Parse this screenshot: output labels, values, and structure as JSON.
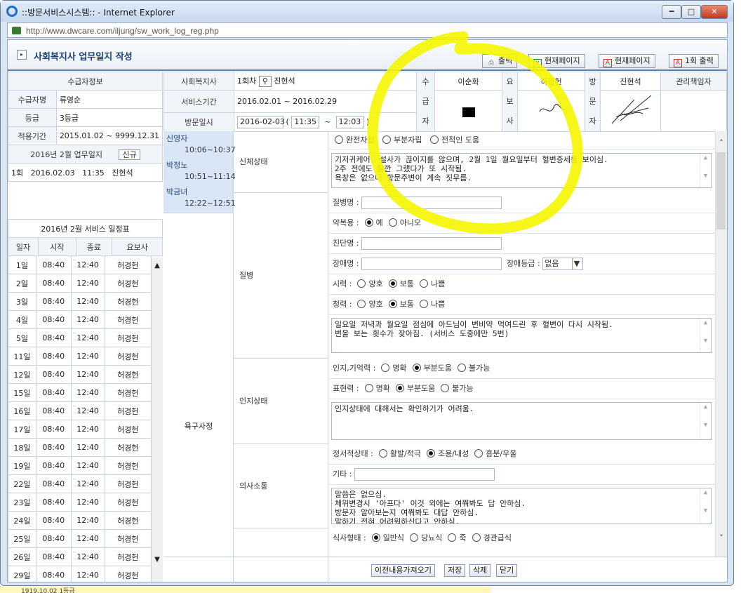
{
  "window": {
    "title": "::방문서비스시스템:: - Internet Explorer",
    "url": "http://www.dwcare.com/iljung/sw_work_log_reg.php",
    "min": "━",
    "max": "□",
    "close": "✕"
  },
  "header": {
    "title": "사회복지사 업무일지 작성",
    "buttons": {
      "print": "출력",
      "current_page_excel": "현재페이지",
      "current_page_pdf": "현재페이지",
      "print_once": "1회 출력"
    }
  },
  "recipient": {
    "section": "수급자정보",
    "name_label": "수급자명",
    "name": "류영순",
    "grade_label": "등급",
    "grade": "3등급",
    "period_label": "적용기간",
    "period": "2015.01.02 ~ 9999.12.31"
  },
  "worklog": {
    "title": "2016년 2월 업무일지",
    "new_button": "신규",
    "entries": [
      {
        "no": "1회",
        "date": "2016.02.03",
        "time": "11:35",
        "staff": "진현석"
      }
    ]
  },
  "schedule": {
    "title": "2016년 2월 서비스 일정표",
    "headers": [
      "일자",
      "시작",
      "종료",
      "요보사"
    ],
    "rows": [
      [
        "1일",
        "08:40",
        "12:40",
        "허경헌"
      ],
      [
        "2일",
        "08:40",
        "12:40",
        "허경헌"
      ],
      [
        "3일",
        "08:40",
        "12:40",
        "허경헌"
      ],
      [
        "4일",
        "08:40",
        "12:40",
        "허경헌"
      ],
      [
        "5일",
        "08:40",
        "12:40",
        "허경헌"
      ],
      [
        "11일",
        "08:40",
        "12:40",
        "허경헌"
      ],
      [
        "12일",
        "08:40",
        "12:40",
        "허경헌"
      ],
      [
        "15일",
        "08:40",
        "12:40",
        "허경헌"
      ],
      [
        "16일",
        "08:40",
        "12:40",
        "허경헌"
      ],
      [
        "17일",
        "08:40",
        "12:40",
        "허경헌"
      ],
      [
        "18일",
        "08:40",
        "12:40",
        "허경헌"
      ],
      [
        "19일",
        "08:40",
        "12:40",
        "허경헌"
      ],
      [
        "22일",
        "08:40",
        "12:40",
        "허경헌"
      ],
      [
        "23일",
        "08:40",
        "12:40",
        "허경헌"
      ],
      [
        "24일",
        "08:40",
        "12:40",
        "허경헌"
      ],
      [
        "25일",
        "08:40",
        "12:40",
        "허경헌"
      ],
      [
        "26일",
        "08:40",
        "12:40",
        "허경헌"
      ],
      [
        "29일",
        "08:40",
        "12:40",
        "허경헌"
      ]
    ]
  },
  "visit": {
    "sw_label": "사회복지사",
    "sw_round": "1회차",
    "sw_name": "진현석",
    "period_label": "서비스기간",
    "period": "2016.02.01 ~ 2016.02.29",
    "date_label": "방문일시",
    "date": "2016-02-03",
    "open_paren": "(",
    "start": "11:35",
    "tilde": "~",
    "end": "12:03",
    "close_paren": ")"
  },
  "signers": {
    "recipient_label": [
      "수",
      "급",
      "자"
    ],
    "recipient_name": "이순화",
    "caregiver_label": [
      "요",
      "보",
      "사"
    ],
    "caregiver_name": "허경헌",
    "visitor_label": [
      "방",
      "문",
      "자"
    ],
    "visitor_name": "진현석",
    "manager_label": "관리책임자"
  },
  "staff_list": [
    {
      "name": "신영자",
      "time": "10:06~10:37"
    },
    {
      "name": "박정노",
      "time": "10:51~11:14"
    },
    {
      "name": "박금녀",
      "time": "12:22~12:51"
    }
  ],
  "categories": {
    "body": "신체상태",
    "disease": "질병",
    "cognitive": "인지상태",
    "needs": "욕구사정",
    "communication": "의사소통"
  },
  "body": {
    "opt1": "완전자립",
    "opt2": "부분자립",
    "opt3": "전적인 도움",
    "text": "기저귀케어. 설사가 끊이지를 않으며, 2월 1일 월요일부터 혈변증세를 보이심.\n2주 전에도 잠깐 그랬다가 또 시작됨.\n욕창은 없으나 항문주변이 계속 짓무름."
  },
  "disease": {
    "name_label": "질병명 :",
    "med_label": "약복용 :",
    "med_yes": "예",
    "med_no": "아니오",
    "diag_label": "진단명 :",
    "disab_label": "장애명 :",
    "disab_grade_label": "장애등급 :",
    "disab_grade": "없음",
    "sight_label": "시력   :",
    "hear_label": "청력   :",
    "good": "양호",
    "normal": "보통",
    "bad": "나쁨",
    "text": "일요일 저녁과 월요일 점심에 아드님이 변비약 먹여드린 후 혈변이 다시 시작됨.\n변을 보는 횟수가 잦아짐. (서비스 도중에만 5번)"
  },
  "cognitive": {
    "memory_label": "인지,기억력  :",
    "expr_label": "표현력     :",
    "clear": "명확",
    "partial": "부분도움",
    "unable": "불가능",
    "text": "인지상태에 대해서는 확인하기가 어려움."
  },
  "communication": {
    "emotion_label": "정서적상태  :",
    "active": "활발/적극",
    "calm": "조용/내성",
    "excited": "흥분/우울",
    "etc_label": "기타     :",
    "text": "말씀은 없으심.\n체위변경시 '아프다' 이것 외에는 여쭤봐도 답 안하심.\n방문자 알아보는지 여쭤봐도 대답 안하심.\n말하기 전혀 어려워하신다고 안하심."
  },
  "meal": {
    "label": "식사형태  :",
    "normal": "일반식",
    "diabetic": "당뇨식",
    "porridge": "죽",
    "tube": "경관급식"
  },
  "bottom": {
    "prev": "이전내용가져오기",
    "save": "저장",
    "delete": "삭제",
    "close": "닫기"
  },
  "status": {
    "text": "1919.10.02  1등급"
  },
  "colors": {
    "highlight": "#f5f500",
    "header_blue": "#1b3f72",
    "name_bg": "#d9e6f5"
  }
}
